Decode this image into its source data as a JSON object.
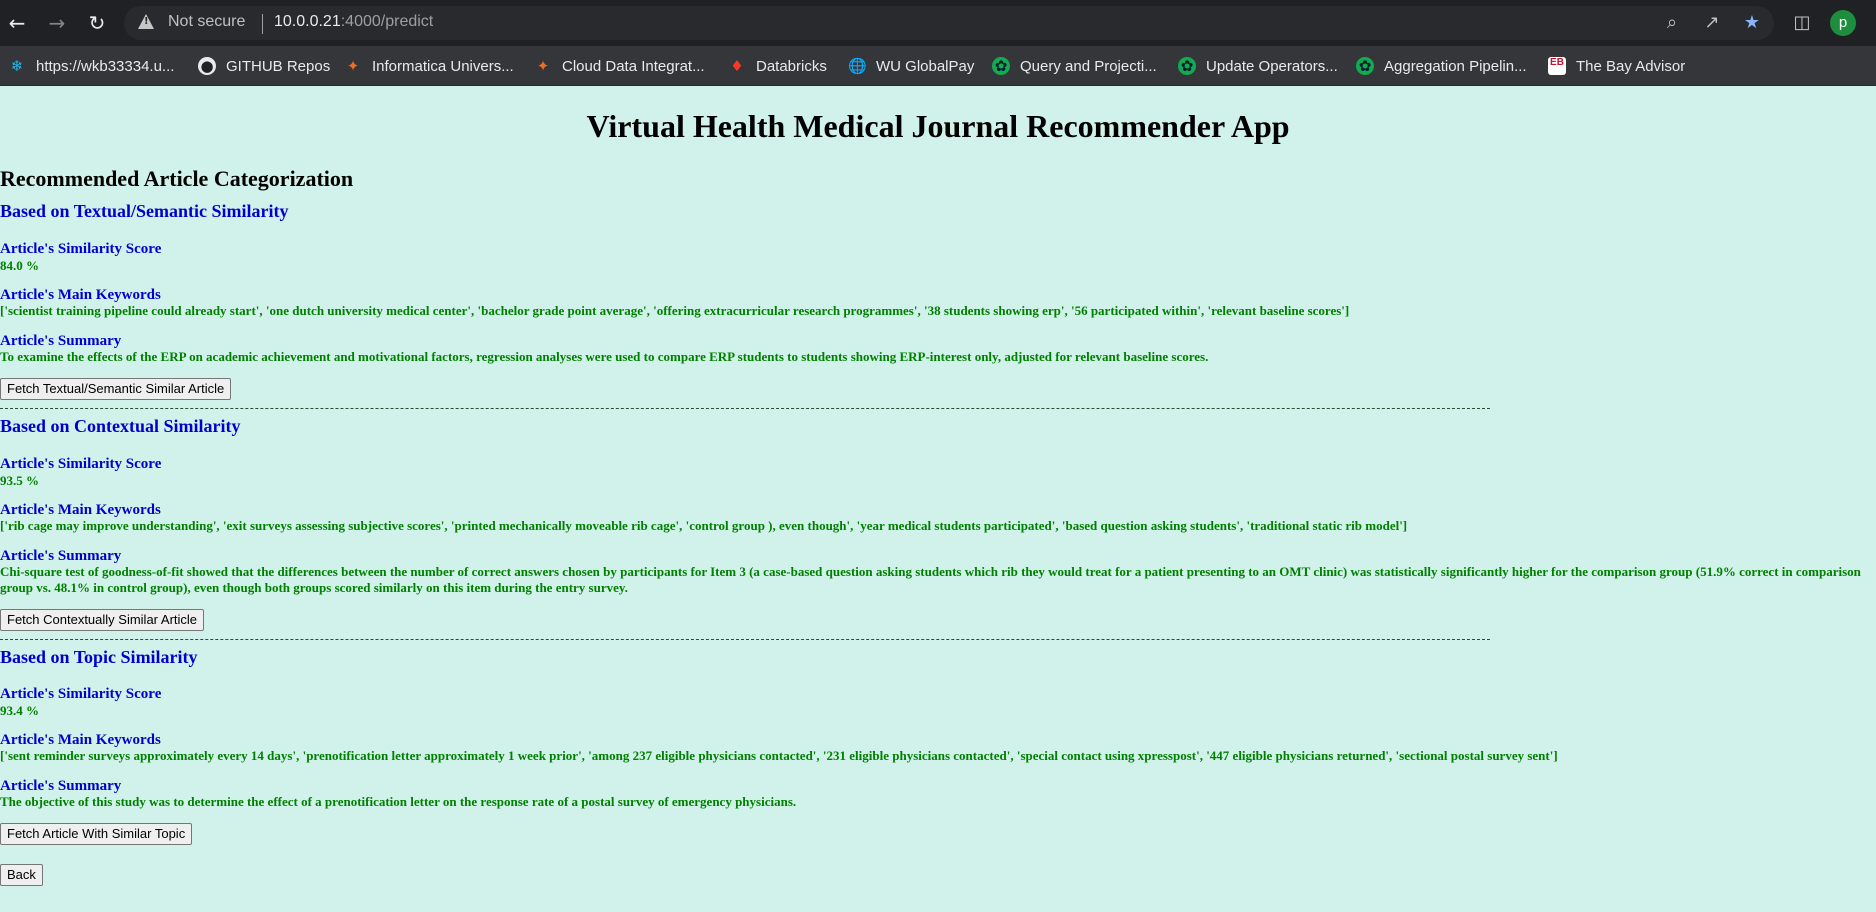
{
  "browser": {
    "security_label": "Not secure",
    "url_host": "10.0.0.21",
    "url_path": ":4000/predict",
    "avatar_letter": "p",
    "bookmarks": [
      {
        "label": "https://wkb33334.u...",
        "icon": "snowflake-icon"
      },
      {
        "label": "GITHUB Repos",
        "icon": "github-icon"
      },
      {
        "label": "Informatica Univers...",
        "icon": "informatica-icon"
      },
      {
        "label": "Cloud Data Integrat...",
        "icon": "informatica-icon"
      },
      {
        "label": "Databricks",
        "icon": "databricks-icon"
      },
      {
        "label": "WU GlobalPay",
        "icon": "globe-icon"
      },
      {
        "label": "Query and Projecti...",
        "icon": "mongodb-leaf-icon"
      },
      {
        "label": "Update Operators...",
        "icon": "mongodb-leaf-icon"
      },
      {
        "label": "Aggregation Pipelin...",
        "icon": "mongodb-leaf-icon"
      },
      {
        "label": "The Bay Advisor",
        "icon": "eb-icon"
      }
    ]
  },
  "page": {
    "title": "Virtual Health Medical Journal Recommender App",
    "section_heading": "Recommended Article Categorization",
    "labels": {
      "score": "Article's Similarity Score",
      "keywords": "Article's Main Keywords",
      "summary": "Article's Summary"
    },
    "blocks": [
      {
        "title": "Based on Textual/Semantic Similarity",
        "score": "84.0 %",
        "keywords": "['scientist training pipeline could already start', 'one dutch university medical center', 'bachelor grade point average', 'offering extracurricular research programmes', '38 students showing erp', '56 participated within', 'relevant baseline scores']",
        "summary": "To examine the effects of the ERP on academic achievement and motivational factors, regression analyses were used to compare ERP students to students showing ERP-interest only, adjusted for relevant baseline scores.",
        "button": "Fetch Textual/Semantic Similar Article"
      },
      {
        "title": "Based on Contextual Similarity",
        "score": "93.5 %",
        "keywords": "['rib cage may improve understanding', 'exit surveys assessing subjective scores', 'printed mechanically moveable rib cage', 'control group ), even though', 'year medical students participated', 'based question asking students', 'traditional static rib model']",
        "summary": "Chi-square test of goodness-of-fit showed that the differences between the number of correct answers chosen by participants for Item 3 (a case-based question asking students which rib they would treat for a patient presenting to an OMT clinic) was statistically significantly higher for the comparison group (51.9% correct in comparison group vs. 48.1% in control group), even though both groups scored similarly on this item during the entry survey.",
        "button": "Fetch Contextually Similar Article"
      },
      {
        "title": "Based on Topic Similarity",
        "score": "93.4 %",
        "keywords": "['sent reminder surveys approximately every 14 days', 'prenotification letter approximately 1 week prior', 'among 237 eligible physicians contacted', '231 eligible physicians contacted', 'special contact using xpresspost', '447 eligible physicians returned', 'sectional postal survey sent']",
        "summary": "The objective of this study was to determine the effect of a prenotification letter on the response rate of a postal survey of emergency physicians.",
        "button": "Fetch Article With Similar Topic"
      }
    ],
    "back_button": "Back"
  }
}
